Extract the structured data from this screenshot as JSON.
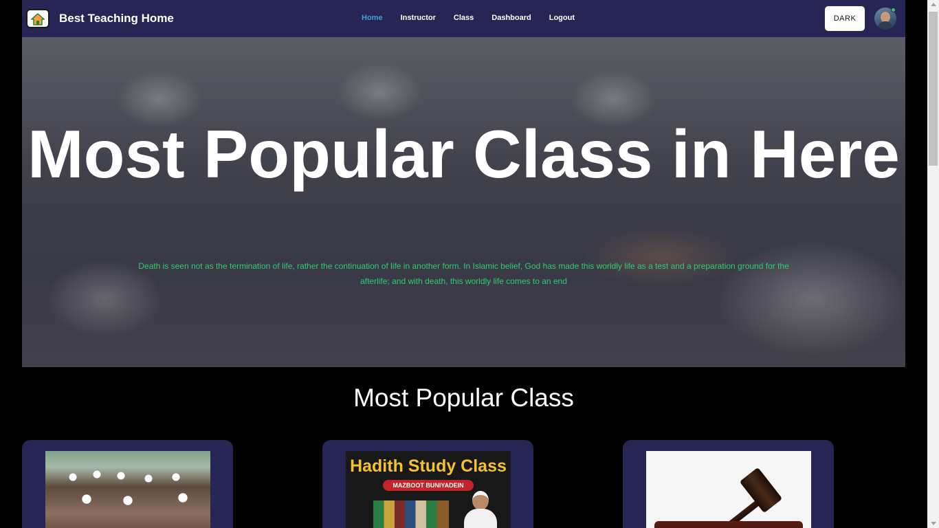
{
  "navbar": {
    "brand": "Best Teaching Home",
    "links": [
      {
        "label": "Home",
        "active": true
      },
      {
        "label": "Instructor",
        "active": false
      },
      {
        "label": "Class",
        "active": false
      },
      {
        "label": "Dashboard",
        "active": false
      },
      {
        "label": "Logout",
        "active": false
      }
    ],
    "theme_button": "DARK",
    "logo_icon": "house-logo-icon",
    "avatar_icon": "user-avatar",
    "colors": {
      "bar": "#272554",
      "active_link": "#3fa0e0",
      "online": "#35c46a"
    }
  },
  "hero": {
    "title": "Most Popular Class in Here",
    "description": "Death is seen not as the termination of life, rather the continuation of life in another form. In Islamic belief, God has made this worldly life as a test and a preparation ground for the afterlife; and with death, this worldly life comes to an end",
    "description_color": "#2ecc71"
  },
  "section": {
    "title": "Most Popular Class"
  },
  "cards": [
    {
      "image": "classroom-students-photo"
    },
    {
      "image": "hadith-study-class-poster",
      "poster_title": "Hadith Study Class",
      "poster_subtitle": "MAZBOOT BUNIYADEIN"
    },
    {
      "image": "judge-gavel-photo"
    }
  ]
}
